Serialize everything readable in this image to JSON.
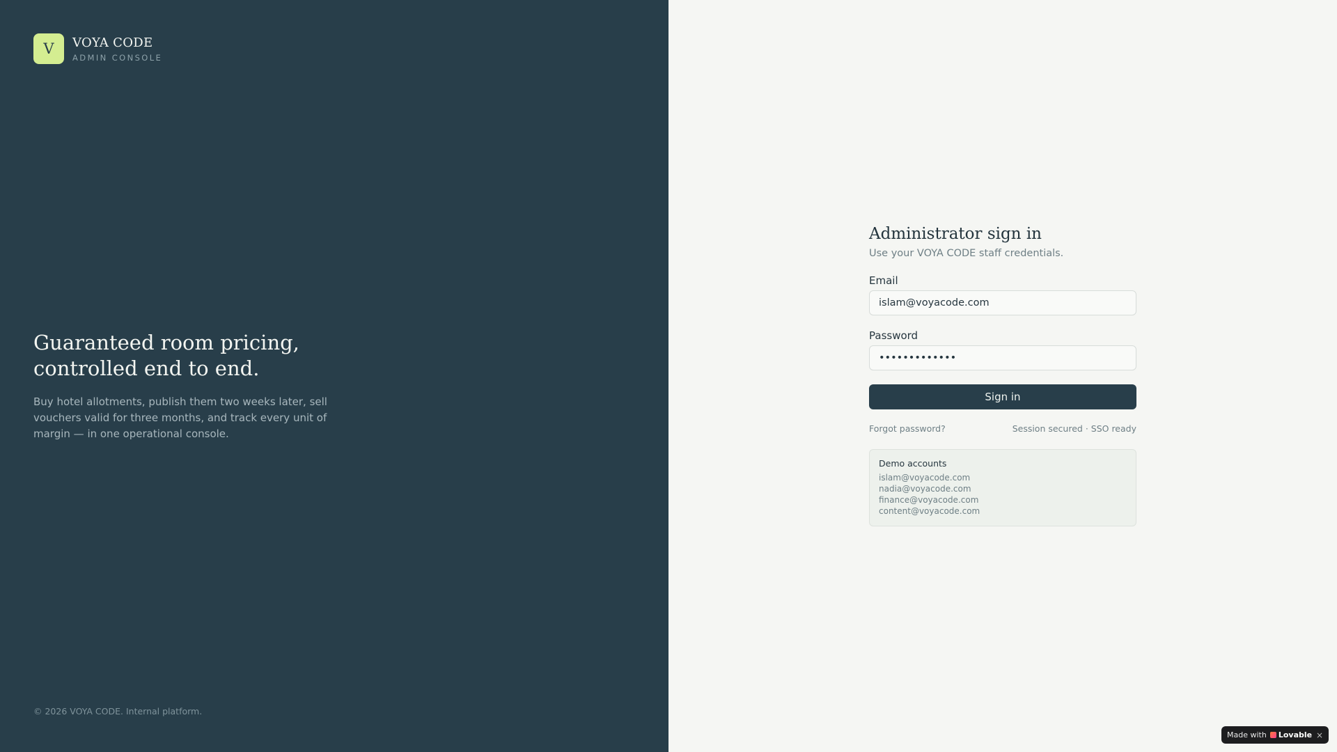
{
  "brand": {
    "logo_letter": "V",
    "name": "VOYA CODE",
    "subtitle": "ADMIN CONSOLE"
  },
  "hero": {
    "title_line1": "Guaranteed room pricing,",
    "title_line2": "controlled end to end.",
    "description": "Buy hotel allotments, publish them two weeks later, sell vouchers valid for three months, and track every unit of margin — in one operational console."
  },
  "footer": {
    "text": "© 2026 VOYA CODE. Internal platform."
  },
  "form": {
    "title": "Administrator sign in",
    "subtitle": "Use your VOYA CODE staff credentials.",
    "email_label": "Email",
    "email_value": "islam@voyacode.com",
    "password_label": "Password",
    "password_value": "•••••••••••••",
    "signin_label": "Sign in",
    "forgot_label": "Forgot password?",
    "session_text": "Session secured · SSO ready"
  },
  "demo": {
    "title": "Demo accounts",
    "accounts": [
      "islam@voyacode.com",
      "nadia@voyacode.com",
      "finance@voyacode.com",
      "content@voyacode.com"
    ]
  },
  "badge": {
    "made_with": "Made with",
    "brand": "Lovable",
    "close": "×"
  },
  "colors": {
    "panel_dark": "#283e4a",
    "logo_accent": "#d4ed91",
    "page_light": "#f5f6f3"
  }
}
